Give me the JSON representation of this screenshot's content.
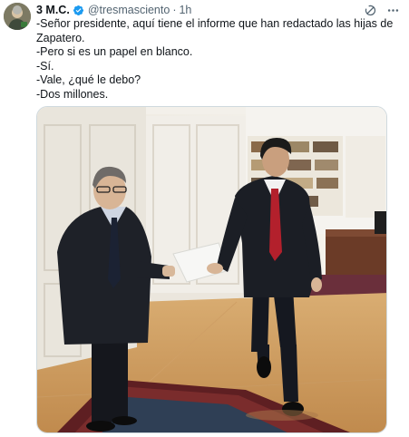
{
  "author": {
    "display_name": "3 M.C.",
    "handle": "@tresmasciento",
    "separator": "·",
    "timestamp": "1h",
    "verified_color": "#1d9bf0"
  },
  "tweet": {
    "lines": [
      "-Señor presidente, aquí tiene el informe que han redactado las hijas de Zapatero.",
      "-Pero si es un papel en blanco.",
      "-Sí.",
      "-Vale, ¿qué le debo?",
      "-Dos millones."
    ]
  },
  "icons": {
    "verified": "verified-badge-icon",
    "grok": "grok-icon",
    "more": "more-options-icon"
  },
  "colors": {
    "text": "#0f1419",
    "secondary": "#536471",
    "border": "#cfd9de"
  }
}
